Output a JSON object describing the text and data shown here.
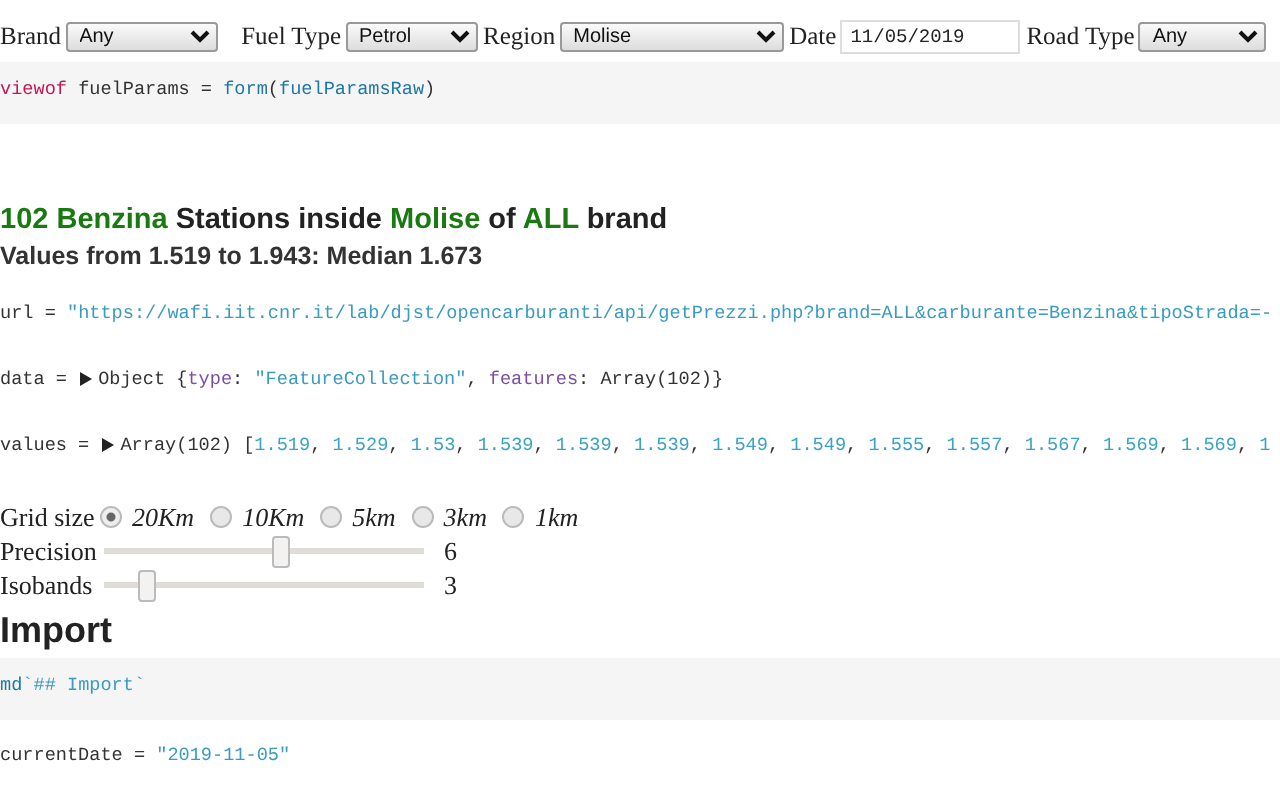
{
  "form": {
    "fields": [
      {
        "kind": "select",
        "label": "Brand",
        "value": "Any"
      },
      {
        "kind": "select",
        "label": "Fuel Type",
        "value": "Petrol"
      },
      {
        "kind": "select",
        "label": "Region",
        "value": "Molise"
      },
      {
        "kind": "date",
        "label": "Date",
        "value": "11/05/2019"
      },
      {
        "kind": "select",
        "label": "Road Type",
        "value": "Any"
      }
    ]
  },
  "form_cell": {
    "shaded": true,
    "tokens": [
      {
        "kind": "keyword",
        "text": "viewof"
      },
      {
        "kind": "plain",
        "text": " fuelParams = "
      },
      {
        "kind": "func",
        "text": "form"
      },
      {
        "kind": "plain",
        "text": "("
      },
      {
        "kind": "func",
        "text": "fuelParamsRaw"
      },
      {
        "kind": "plain",
        "text": ")"
      }
    ]
  },
  "summary": {
    "title": [
      {
        "text": "102 Benzina",
        "highlight": true
      },
      {
        "text": " Stations inside ",
        "highlight": false
      },
      {
        "text": "Molise",
        "highlight": true
      },
      {
        "text": " of ",
        "highlight": false
      },
      {
        "text": "ALL",
        "highlight": true
      },
      {
        "text": " brand",
        "highlight": false
      }
    ],
    "subtitle": "Values from 1.519 to 1.943: Median 1.673"
  },
  "outputs": [
    {
      "shaded": false,
      "tokens": [
        {
          "kind": "plain",
          "text": "url = "
        },
        {
          "kind": "string",
          "text": "\"https://wafi.iit.cnr.it/lab/djst/opencarburanti/api/getPrezzi.php?brand=ALL&carburante=Benzina&tipoStrada=-"
        }
      ]
    },
    {
      "shaded": false,
      "tokens": [
        {
          "kind": "plain",
          "text": "data = "
        },
        {
          "kind": "toggle"
        },
        {
          "kind": "plain",
          "text": "Object {"
        },
        {
          "kind": "prop",
          "text": "type"
        },
        {
          "kind": "plain",
          "text": ": "
        },
        {
          "kind": "string",
          "text": "\"FeatureCollection\""
        },
        {
          "kind": "plain",
          "text": ", "
        },
        {
          "kind": "prop",
          "text": "features"
        },
        {
          "kind": "plain",
          "text": ": Array(102)}"
        }
      ]
    },
    {
      "shaded": false,
      "tokens": [
        {
          "kind": "plain",
          "text": "values = "
        },
        {
          "kind": "toggle"
        },
        {
          "kind": "plain",
          "text": "Array(102) ["
        },
        {
          "kind": "number",
          "text": "1.519"
        },
        {
          "kind": "plain",
          "text": ", "
        },
        {
          "kind": "number",
          "text": "1.529"
        },
        {
          "kind": "plain",
          "text": ", "
        },
        {
          "kind": "number",
          "text": "1.53"
        },
        {
          "kind": "plain",
          "text": ", "
        },
        {
          "kind": "number",
          "text": "1.539"
        },
        {
          "kind": "plain",
          "text": ", "
        },
        {
          "kind": "number",
          "text": "1.539"
        },
        {
          "kind": "plain",
          "text": ", "
        },
        {
          "kind": "number",
          "text": "1.539"
        },
        {
          "kind": "plain",
          "text": ", "
        },
        {
          "kind": "number",
          "text": "1.549"
        },
        {
          "kind": "plain",
          "text": ", "
        },
        {
          "kind": "number",
          "text": "1.549"
        },
        {
          "kind": "plain",
          "text": ", "
        },
        {
          "kind": "number",
          "text": "1.555"
        },
        {
          "kind": "plain",
          "text": ", "
        },
        {
          "kind": "number",
          "text": "1.557"
        },
        {
          "kind": "plain",
          "text": ", "
        },
        {
          "kind": "number",
          "text": "1.567"
        },
        {
          "kind": "plain",
          "text": ", "
        },
        {
          "kind": "number",
          "text": "1.569"
        },
        {
          "kind": "plain",
          "text": ", "
        },
        {
          "kind": "number",
          "text": "1.569"
        },
        {
          "kind": "plain",
          "text": ", "
        },
        {
          "kind": "number",
          "text": "1"
        }
      ]
    }
  ],
  "grid_size": {
    "label": "Grid size",
    "options": [
      {
        "label": "20Km",
        "selected": true
      },
      {
        "label": "10Km",
        "selected": false
      },
      {
        "label": "5km",
        "selected": false
      },
      {
        "label": "3km",
        "selected": false
      },
      {
        "label": "1km",
        "selected": false
      }
    ]
  },
  "sliders": [
    {
      "label": "Precision",
      "level": 0.55,
      "reading": "6"
    },
    {
      "label": "Isobands",
      "level": 0.13,
      "reading": "3"
    }
  ],
  "section": {
    "title": "Import"
  },
  "cells": [
    {
      "shaded": true,
      "tokens": [
        {
          "kind": "func",
          "text": "md"
        },
        {
          "kind": "string",
          "text": "`## Import`"
        }
      ]
    },
    {
      "shaded": false,
      "tokens": [
        {
          "kind": "plain",
          "text": "currentDate = "
        },
        {
          "kind": "string",
          "text": "\"2019-11-05\""
        }
      ]
    }
  ]
}
